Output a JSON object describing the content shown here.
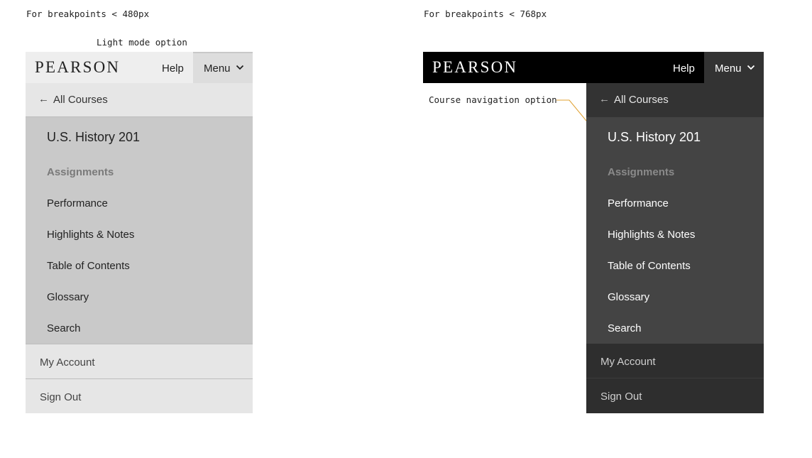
{
  "captions": {
    "small": "For breakpoints < 480px",
    "light_mode": "Light mode option",
    "medium": "For breakpoints < 768px",
    "course_nav": "Course navigation option"
  },
  "colors": {
    "callout_line": "#e0a030",
    "dark_header": "#000000",
    "dark_course": "#444444",
    "light_course": "#c9c9c9"
  },
  "light": {
    "logo": "PEARSON",
    "help": "Help",
    "menu": "Menu",
    "back": "All Courses",
    "back_arrow": "←",
    "course_title": "U.S. History 201",
    "nav": [
      "Assignments",
      "Performance",
      "Highlights & Notes",
      "Table of Contents",
      "Glossary",
      "Search"
    ],
    "account": [
      "My Account",
      "Sign Out"
    ]
  },
  "dark": {
    "logo": "PEARSON",
    "help": "Help",
    "menu": "Menu",
    "back": "All Courses",
    "back_arrow": "←",
    "course_title": "U.S. History 201",
    "nav": [
      "Assignments",
      "Performance",
      "Highlights & Notes",
      "Table of Contents",
      "Glossary",
      "Search"
    ],
    "account": [
      "My Account",
      "Sign Out"
    ]
  },
  "icons": [
    "back-arrow-icon",
    "chevron-down-icon"
  ]
}
